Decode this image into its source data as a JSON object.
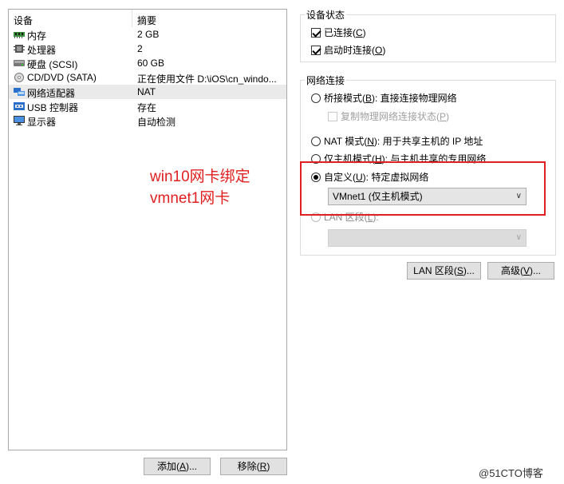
{
  "device_list": {
    "headers": {
      "device": "设备",
      "summary": "摘要"
    },
    "rows": [
      {
        "icon": "memory-icon",
        "name": "内存",
        "summary": "2 GB"
      },
      {
        "icon": "processor-icon",
        "name": "处理器",
        "summary": "2"
      },
      {
        "icon": "hard-disk-icon",
        "name": "硬盘 (SCSI)",
        "summary": "60 GB"
      },
      {
        "icon": "cd-dvd-icon",
        "name": "CD/DVD (SATA)",
        "summary": "正在使用文件 D:\\iOS\\cn_windo..."
      },
      {
        "icon": "network-adapter-icon",
        "name": "网络适配器",
        "summary": "NAT",
        "selected": true
      },
      {
        "icon": "usb-controller-icon",
        "name": "USB 控制器",
        "summary": "存在"
      },
      {
        "icon": "display-icon",
        "name": "显示器",
        "summary": "自动检测"
      }
    ]
  },
  "buttons": {
    "add": {
      "pre": "添加(",
      "key": "A",
      "post": ")..."
    },
    "remove": {
      "pre": "移除(",
      "key": "R",
      "post": ")"
    },
    "lan_segments": {
      "pre": "LAN 区段(",
      "key": "S",
      "post": ")..."
    },
    "advanced": {
      "pre": "高级(",
      "key": "V",
      "post": ")..."
    }
  },
  "device_status": {
    "title": "设备状态",
    "connected": {
      "pre": "已连接(",
      "key": "C",
      "post": ")",
      "checked": true
    },
    "connect_at_power_on": {
      "pre": "启动时连接(",
      "key": "O",
      "post": ")",
      "checked": true
    }
  },
  "network_connection": {
    "title": "网络连接",
    "bridged": {
      "pre": "桥接模式(",
      "key": "B",
      "post": "): 直接连接物理网络",
      "selected": false
    },
    "replicate": {
      "pre": "复制物理网络连接状态(",
      "key": "P",
      "post": ")",
      "checked": false
    },
    "nat": {
      "pre": "NAT 模式(",
      "key": "N",
      "post": "): 用于共享主机的 IP 地址",
      "selected": false
    },
    "host_only": {
      "pre": "仅主机模式(",
      "key": "H",
      "post": "): 与主机共享的专用网络",
      "selected": false
    },
    "custom": {
      "pre": "自定义(",
      "key": "U",
      "post": "): 特定虚拟网络",
      "selected": true
    },
    "custom_value": "VMnet1 (仅主机模式)",
    "lan_segment": {
      "pre": "LAN 区段(",
      "key": "L",
      "post": "):",
      "selected": false
    },
    "lan_segment_value": ""
  },
  "annotation": {
    "line1": "win10网卡绑定",
    "line2": "vmnet1网卡",
    "color": "#e02020"
  },
  "watermark": "@51CTO博客"
}
